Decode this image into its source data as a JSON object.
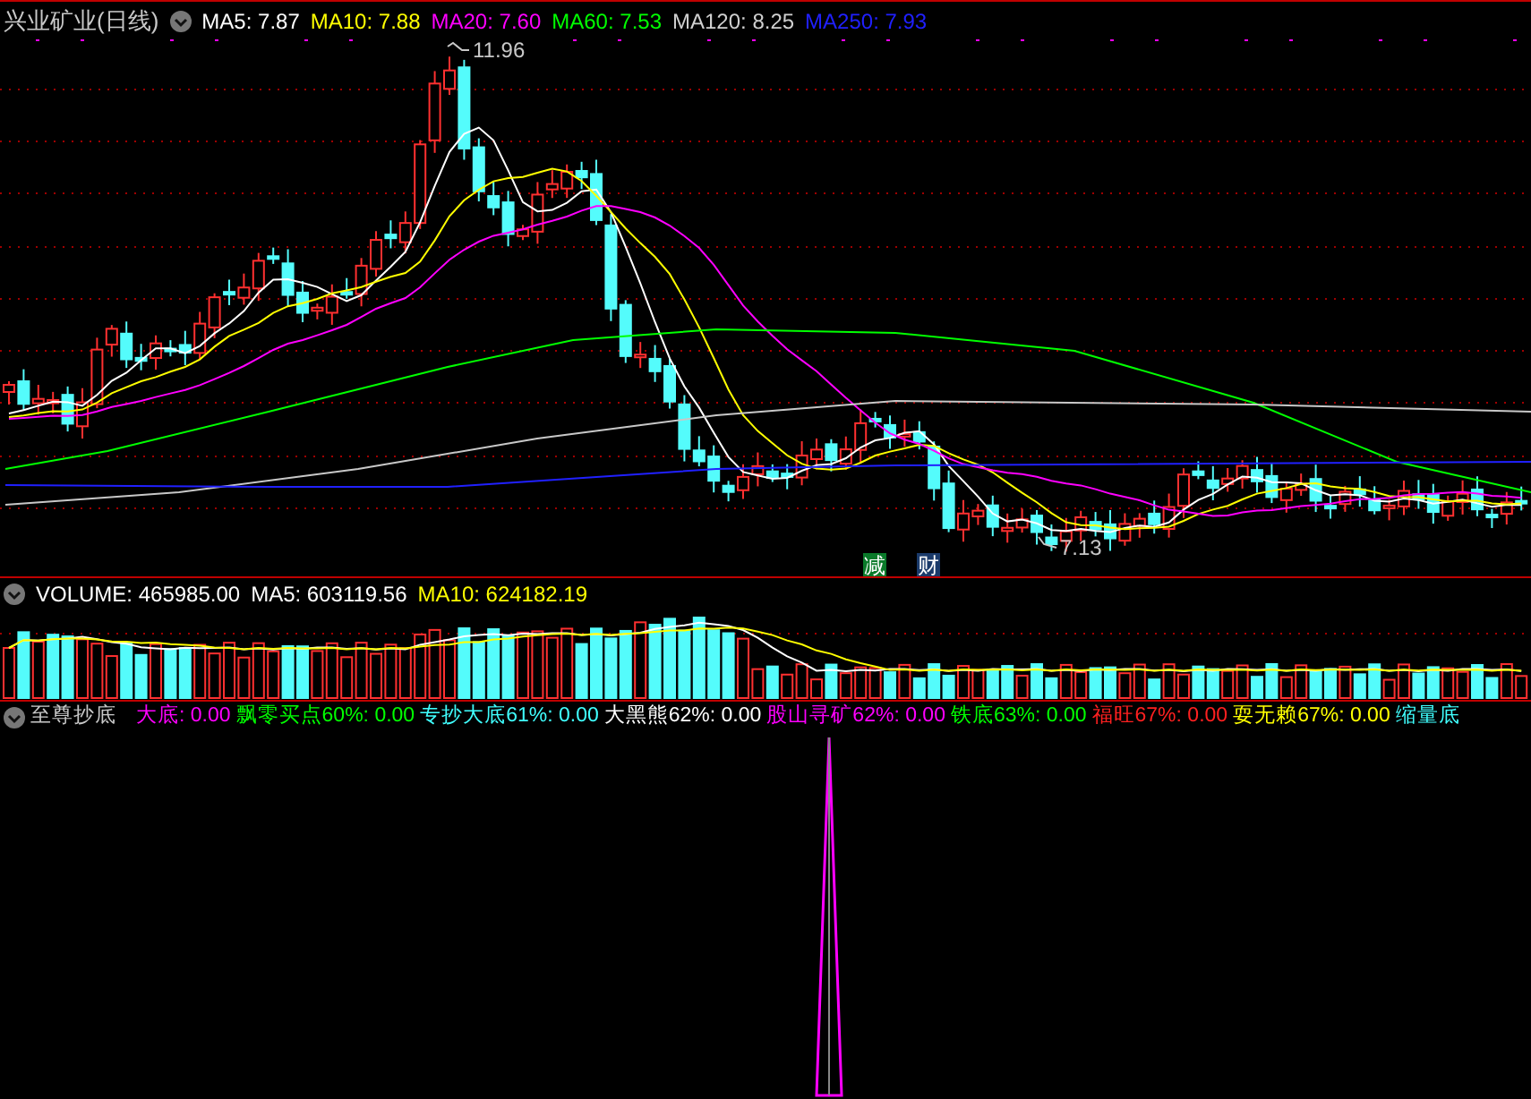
{
  "price_header": {
    "title": "兴业矿业(日线)",
    "averages": [
      {
        "label": "MA5: 7.87",
        "color": "#ffffff"
      },
      {
        "label": "MA10: 7.88",
        "color": "#ffff00"
      },
      {
        "label": "MA20: 7.60",
        "color": "#ff00ff"
      },
      {
        "label": "MA60: 7.53",
        "color": "#00ff00"
      },
      {
        "label": "MA120: 8.25",
        "color": "#d0d0d0"
      },
      {
        "label": "MA250: 7.93",
        "color": "#2020ff"
      }
    ]
  },
  "price_chart": {
    "high_label": "11.96",
    "low_label": "7.13",
    "badges": [
      {
        "text": "减",
        "color": "#0a7a2a"
      },
      {
        "text": "财",
        "color": "#1a3a6a"
      }
    ]
  },
  "volume_header": {
    "items": [
      {
        "label": "VOLUME: 465985.00",
        "color": "#ffffff"
      },
      {
        "label": "MA5: 603119.56",
        "color": "#ffffff"
      },
      {
        "label": "MA10: 624182.19",
        "color": "#ffff00"
      }
    ]
  },
  "indicator_header": {
    "title": "至尊抄底",
    "items": [
      {
        "label": "大底: 0.00",
        "color": "#ff00ff"
      },
      {
        "label": "飘零买点60%: 0.00",
        "color": "#00ff00"
      },
      {
        "label": "专抄大底61%: 0.00",
        "color": "#40ffff"
      },
      {
        "label": "大黑熊62%: 0.00",
        "color": "#ffffff"
      },
      {
        "label": "股山寻矿62%: 0.00",
        "color": "#ff00ff"
      },
      {
        "label": "铁底63%: 0.00",
        "color": "#00ff00"
      },
      {
        "label": "福旺67%: 0.00",
        "color": "#ff2020"
      },
      {
        "label": "耍无赖67%: 0.00",
        "color": "#ffff00"
      },
      {
        "label": "缩量底",
        "color": "#40ffff"
      }
    ]
  }
}
